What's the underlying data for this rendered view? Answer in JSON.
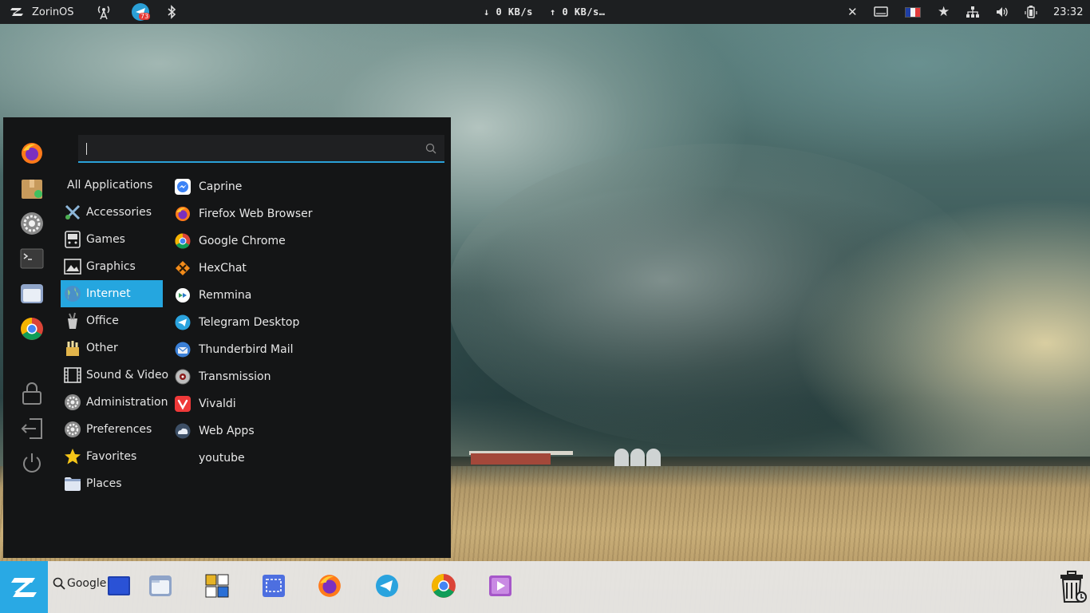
{
  "top_panel": {
    "distro_label": "ZorinOS",
    "tray_icons": [
      "network-antenna-icon",
      "telegram-tray-icon",
      "bluetooth-icon"
    ],
    "telegram_badge": "73",
    "net_down": "↓ 0 KB/s",
    "net_up": "↑ 0 KB/s…",
    "right_icons": [
      "close-icon",
      "display-icon",
      "keyboard-layout-flag-icon",
      "star-icon",
      "network-icon",
      "volume-icon",
      "battery-icon"
    ],
    "clock": "23:32"
  },
  "menu": {
    "search": {
      "value": "",
      "placeholder": ""
    },
    "favorites": [
      "firefox-icon",
      "software-store-icon",
      "settings-icon",
      "terminal-icon",
      "files-icon",
      "chrome-icon"
    ],
    "session": [
      "lock-icon",
      "logout-icon",
      "power-icon"
    ],
    "categories": [
      {
        "label": "All Applications",
        "icon": ""
      },
      {
        "label": "Accessories",
        "icon": "accessories-icon"
      },
      {
        "label": "Games",
        "icon": "games-icon"
      },
      {
        "label": "Graphics",
        "icon": "graphics-icon"
      },
      {
        "label": "Internet",
        "icon": "internet-icon",
        "active": true
      },
      {
        "label": "Office",
        "icon": "office-icon"
      },
      {
        "label": "Other",
        "icon": "other-icon"
      },
      {
        "label": "Sound & Video",
        "icon": "sound-video-icon"
      },
      {
        "label": "Administration",
        "icon": "administration-icon"
      },
      {
        "label": "Preferences",
        "icon": "preferences-icon"
      },
      {
        "label": "Favorites",
        "icon": "favorites-star-icon"
      },
      {
        "label": "Places",
        "icon": "places-folder-icon"
      }
    ],
    "apps": [
      {
        "label": "Caprine",
        "icon": "caprine-icon"
      },
      {
        "label": "Firefox Web Browser",
        "icon": "firefox-icon"
      },
      {
        "label": "Google Chrome",
        "icon": "chrome-icon"
      },
      {
        "label": "HexChat",
        "icon": "hexchat-icon"
      },
      {
        "label": "Remmina",
        "icon": "remmina-icon"
      },
      {
        "label": "Telegram Desktop",
        "icon": "telegram-icon"
      },
      {
        "label": "Thunderbird Mail",
        "icon": "thunderbird-icon"
      },
      {
        "label": "Transmission",
        "icon": "transmission-icon"
      },
      {
        "label": "Vivaldi",
        "icon": "vivaldi-icon"
      },
      {
        "label": "Web Apps",
        "icon": "webapps-icon"
      },
      {
        "label": "youtube",
        "icon": ""
      }
    ]
  },
  "taskbar": {
    "search_label": "Google",
    "apps": [
      "workspace-icon",
      "files-icon",
      "office-suite-icon",
      "screenshot-icon",
      "firefox-icon",
      "telegram-icon",
      "chrome-icon",
      "video-player-icon"
    ],
    "trash": "trash-icon"
  },
  "colors": {
    "accent": "#25a6df",
    "panel_bg": "#1d1f21",
    "menu_bg": "#141516"
  }
}
